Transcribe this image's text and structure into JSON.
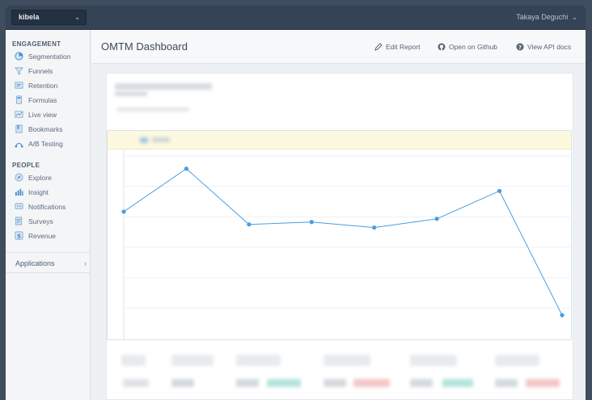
{
  "topbar": {
    "project": "kibela",
    "user": "Takaya Deguchi"
  },
  "sidebar": {
    "engagement_title": "ENGAGEMENT",
    "engagement_items": [
      {
        "label": "Segmentation",
        "icon": "pie-chart-icon"
      },
      {
        "label": "Funnels",
        "icon": "funnel-icon"
      },
      {
        "label": "Retention",
        "icon": "retention-icon"
      },
      {
        "label": "Formulas",
        "icon": "calculator-icon"
      },
      {
        "label": "Live view",
        "icon": "live-chart-icon"
      },
      {
        "label": "Bookmarks",
        "icon": "bookmark-icon"
      },
      {
        "label": "A/B Testing",
        "icon": "ab-test-icon"
      }
    ],
    "people_title": "PEOPLE",
    "people_items": [
      {
        "label": "Explore",
        "icon": "compass-icon"
      },
      {
        "label": "Insight",
        "icon": "insight-icon"
      },
      {
        "label": "Notifications",
        "icon": "notification-icon"
      },
      {
        "label": "Surveys",
        "icon": "survey-icon"
      },
      {
        "label": "Revenue",
        "icon": "dollar-icon"
      }
    ],
    "applications": "Applications"
  },
  "header": {
    "title": "OMTM Dashboard",
    "edit_report": "Edit Report",
    "open_github": "Open on Github",
    "api_docs": "View API docs"
  },
  "colors": {
    "accent": "#4a9de0",
    "topbar": "#344355"
  },
  "chart_data": {
    "type": "line",
    "x": [
      1,
      2,
      3,
      4,
      5,
      6,
      7,
      8
    ],
    "series": [
      {
        "values": [
          0.65,
          0.92,
          0.57,
          0.585,
          0.55,
          0.605,
          0.78,
          0.0
        ]
      }
    ],
    "ylim": [
      0,
      1
    ],
    "grid": true
  }
}
